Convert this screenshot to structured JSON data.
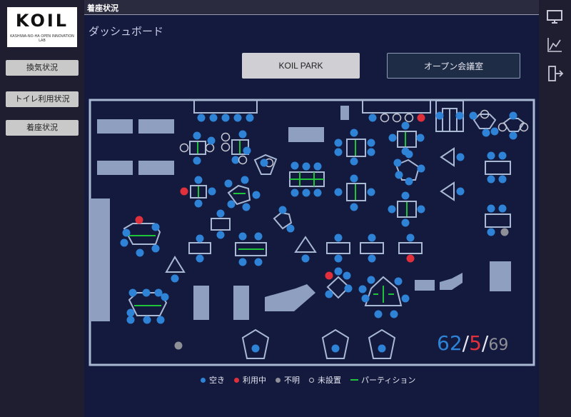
{
  "logo": {
    "text": "KOIL",
    "subtext": "KASHIWA-NO-HA OPEN INNOVATION LAB"
  },
  "header": {
    "title": "着座状況"
  },
  "sidebar": {
    "items": [
      {
        "label": "換気状況"
      },
      {
        "label": "トイレ利用状況"
      },
      {
        "label": "着座状況"
      }
    ]
  },
  "page": {
    "heading": "ダッシュボード"
  },
  "tabs": [
    {
      "label": "KOIL PARK",
      "active": true
    },
    {
      "label": "オープン会議室",
      "active": false
    }
  ],
  "right_bar": {
    "icons": [
      "monitor-icon",
      "chart-line-icon",
      "exit-door-icon"
    ]
  },
  "counter": {
    "available": "62",
    "in_use": "5",
    "total": "69",
    "sep": "/"
  },
  "legend": [
    {
      "label": "空き",
      "type": "dot",
      "color": "#2f83d6"
    },
    {
      "label": "利用中",
      "type": "dot",
      "color": "#e0303c"
    },
    {
      "label": "不明",
      "type": "dot",
      "color": "#8f8f97"
    },
    {
      "label": "未設置",
      "type": "ring",
      "color": "#c8c8d2"
    },
    {
      "label": "パーティション",
      "type": "line",
      "color": "#1fc43a"
    }
  ],
  "colors": {
    "available": "#2f83d6",
    "in_use": "#e0303c",
    "unknown": "#8f8f97",
    "not_installed": "#c8c8d2",
    "partition": "#1fc43a"
  }
}
